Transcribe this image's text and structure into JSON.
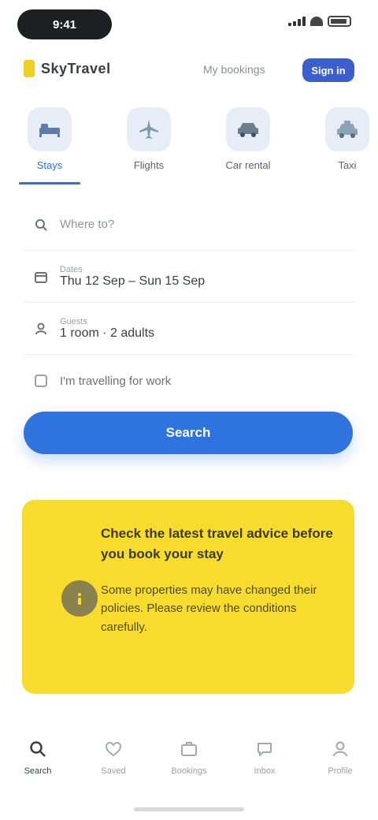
{
  "status": {
    "time": "9:41"
  },
  "header": {
    "logo_text": "SkyTravel",
    "link": "My bookings",
    "button": "Sign in"
  },
  "service_tabs": [
    {
      "label": "Stays",
      "icon": "bed-icon",
      "active": true
    },
    {
      "label": "Flights",
      "icon": "plane-icon",
      "active": false
    },
    {
      "label": "Car rental",
      "icon": "car-icon",
      "active": false
    },
    {
      "label": "Taxi",
      "icon": "taxi-icon",
      "active": false
    }
  ],
  "form": {
    "destination_placeholder": "Where to?",
    "dates_label": "Dates",
    "dates_value": "Thu 12 Sep – Sun 15 Sep",
    "guests_label": "Guests",
    "guests_value": "1 room · 2 adults",
    "extra_option": "I'm travelling for work"
  },
  "search_button": "Search",
  "promo": {
    "icon": "info-icon",
    "title": "Check the latest travel advice before you book your stay",
    "body": "Some properties may have changed their policies. Please review the conditions carefully."
  },
  "bottom_nav": [
    {
      "label": "Search",
      "icon": "search-icon",
      "active": true
    },
    {
      "label": "Saved",
      "icon": "heart-icon",
      "active": false
    },
    {
      "label": "Bookings",
      "icon": "suitcase-icon",
      "active": false
    },
    {
      "label": "Inbox",
      "icon": "chat-icon",
      "active": false
    },
    {
      "label": "Profile",
      "icon": "user-icon",
      "active": false
    }
  ],
  "colors": {
    "primary": "#2f73df",
    "promo": "#f8dc2d",
    "logo": "#f2cf21"
  }
}
